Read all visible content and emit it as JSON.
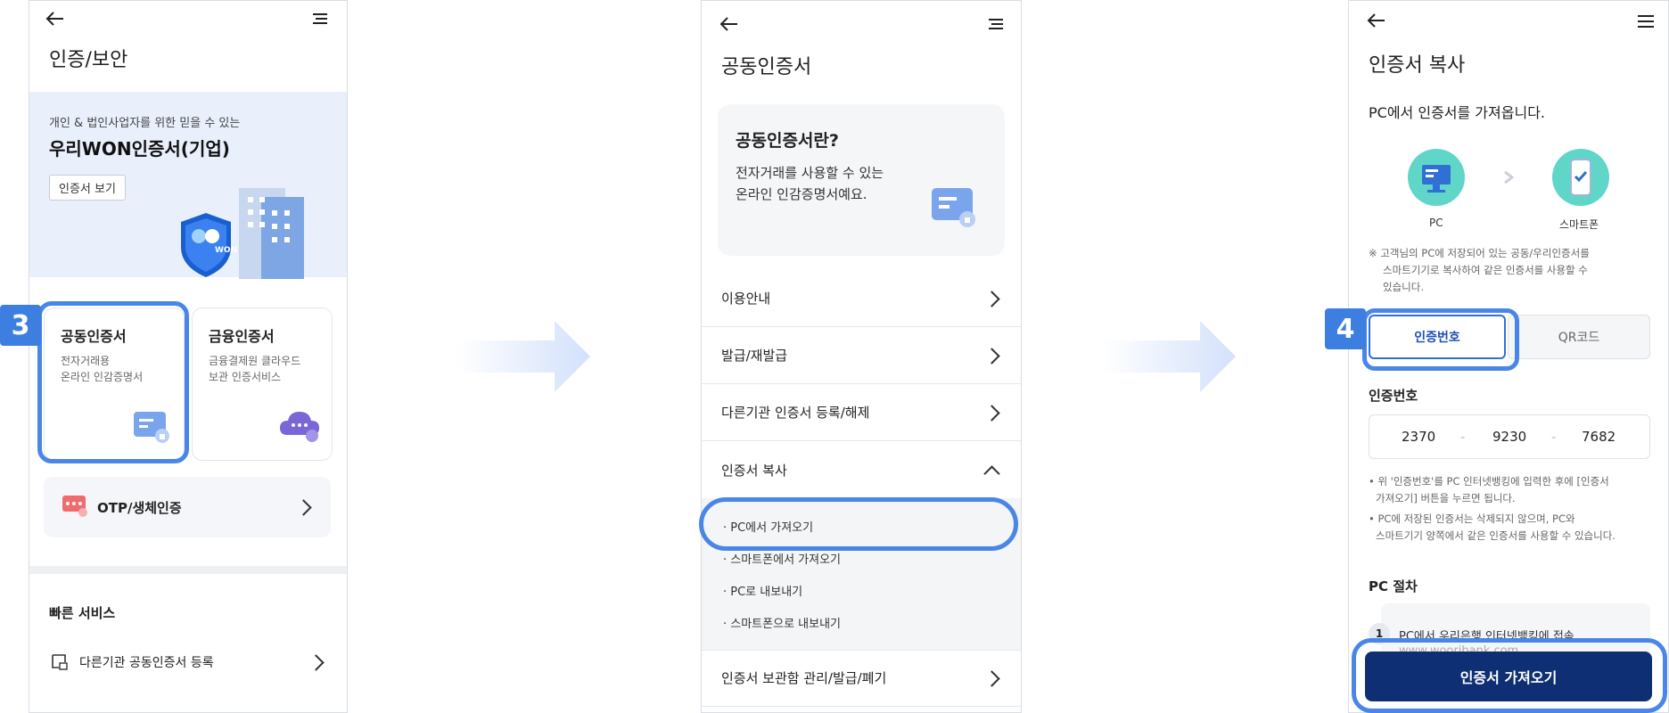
{
  "screen1": {
    "title": "인증/보안",
    "banner": {
      "subtitle": "개인 & 법인사업자를 위한 믿을 수 있는",
      "heading": "우리WON인증서(기업)",
      "button": "인증서 보기",
      "shield_text": "WON"
    },
    "cards": [
      {
        "title": "공동인증서",
        "desc1": "전자거래용",
        "desc2": "온라인 인감증명서"
      },
      {
        "title": "금융인증서",
        "desc1": "금융결제원 클라우드",
        "desc2": "보관 인증서비스"
      }
    ],
    "otp_label": "OTP/생체인증",
    "quick_services": "빠른 서비스",
    "quick_item": "다른기관 공동인증서 등록",
    "step_badge": "3"
  },
  "screen2": {
    "title": "공동인증서",
    "info_title": "공동인증서란?",
    "info_line1": "전자거래를 사용할 수 있는",
    "info_line2": "온라인 인감증명서예요.",
    "menu": [
      "이용안내",
      "발급/재발급",
      "다른기관 인증서 등록/해제",
      "인증서 복사"
    ],
    "sub_items": [
      "· PC에서 가져오기",
      "· 스마트폰에서 가져오기",
      "· PC로 내보내기",
      "· 스마트폰으로 내보내기"
    ],
    "last_menu": "인증서 보관함 관리/발급/폐기"
  },
  "screen3": {
    "title": "인증서 복사",
    "subtitle": "PC에서 인증서를 가져옵니다.",
    "pc_label": "PC",
    "phone_label": "스마트폰",
    "note_lines": [
      "※ 고객님의 PC에 저장되어 있는 공동/우리인증서를",
      "스마트기기로 복사하여 같은 인증서를 사용할 수",
      "있습니다."
    ],
    "tab_active": "인증번호",
    "tab_inactive": "QR코드",
    "step_badge": "4",
    "code_label": "인증번호",
    "code_parts": [
      "2370",
      "9230",
      "7682"
    ],
    "code_sep": "-",
    "bullets": [
      "• 위 '인증번호'를 PC 인터넷뱅킹에 입력한 후에 [인증서",
      "가져오기] 버튼을 누르면 됩니다.",
      "• PC에 저장된 인증서는 삭제되지 않으며, PC와",
      "스마트기기 양쪽에서 같은 인증서를 사용할 수 있습니다."
    ],
    "pc_steps_title": "PC 절차",
    "step_num": "1",
    "step_text": "PC에서 우리은행 인터넷뱅킹에 접속",
    "step_url": "www.wooribank.com",
    "cta": "인증서 가져오기"
  },
  "colors": {
    "primary": "#0e2f73",
    "accent": "#3d7fe0",
    "highlight": "#4a86e8",
    "banner_bg": "#e9f0fc",
    "teal": "#5fd6c8"
  }
}
